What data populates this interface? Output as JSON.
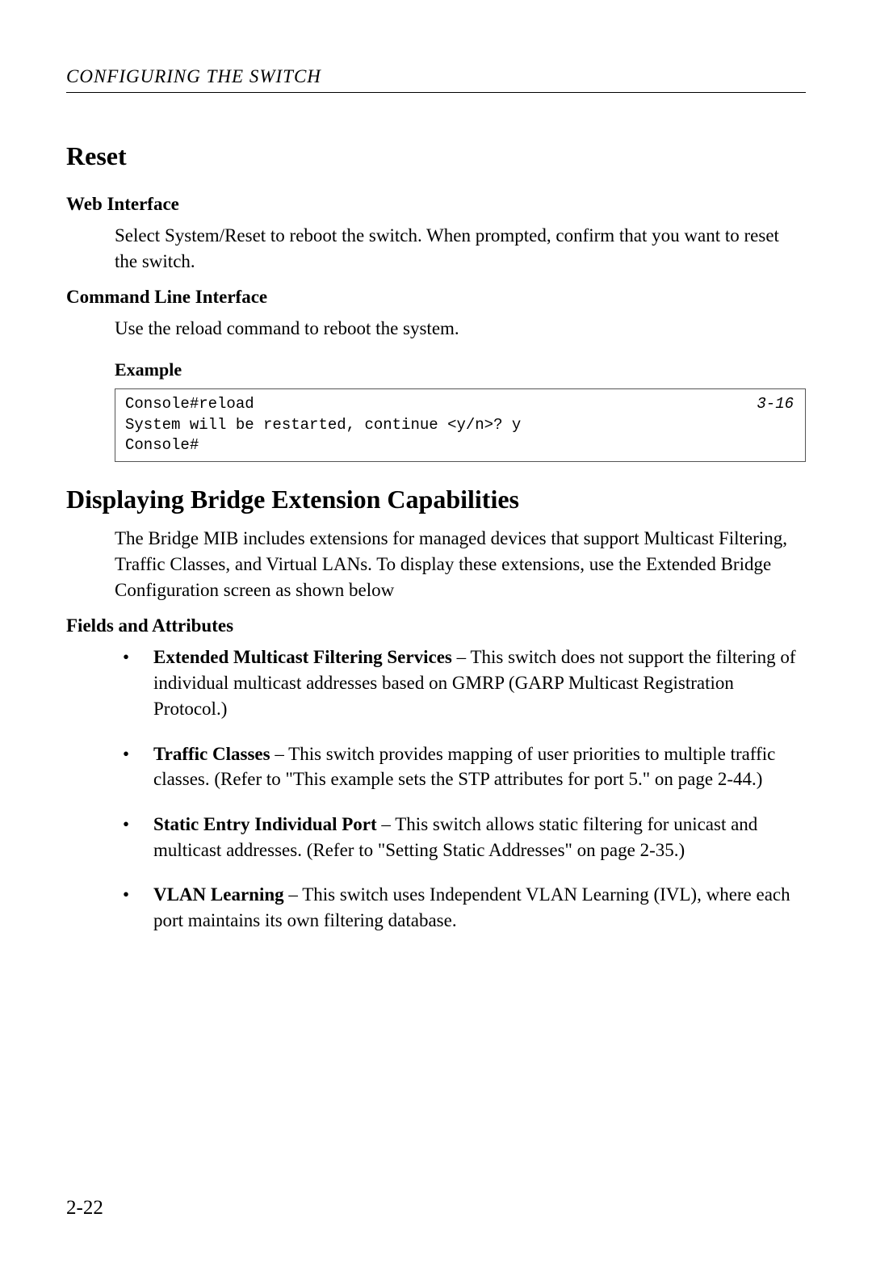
{
  "running_head": "CONFIGURING THE SWITCH",
  "section_reset": {
    "heading": "Reset",
    "web_interface_heading": "Web Interface",
    "web_interface_text": "Select System/Reset to reboot the switch. When prompted, confirm that you want to reset the switch.",
    "cli_heading": "Command Line Interface",
    "cli_text": "Use the reload command to reboot the system.",
    "example_heading": "Example",
    "example_ref": "3-16",
    "example_code": "Console#reload\nSystem will be restarted, continue <y/n>? y\nConsole#"
  },
  "section_bridge": {
    "heading": "Displaying Bridge Extension Capabilities",
    "intro_text": "The Bridge MIB includes extensions for managed devices that support Multicast Filtering, Traffic Classes, and Virtual LANs. To display these extensions, use the Extended Bridge Configuration screen as shown below",
    "fields_heading": "Fields and Attributes",
    "items": [
      {
        "term": "Extended Multicast Filtering Services",
        "desc": " – This switch does not support the filtering of individual multicast addresses based on GMRP (GARP Multicast Registration Protocol.)"
      },
      {
        "term": "Traffic Classes",
        "desc": " – This switch provides mapping of user priorities to multiple traffic classes. (Refer to \"This example sets the STP attributes for port 5.\" on page 2-44.)"
      },
      {
        "term": "Static Entry Individual Port",
        "desc": " – This switch allows static filtering for unicast and multicast addresses. (Refer to \"Setting Static Addresses\" on page 2-35.)"
      },
      {
        "term": "VLAN Learning",
        "desc": " – This switch uses Independent VLAN Learning (IVL), where each port maintains its own filtering database."
      }
    ]
  },
  "page_number": "2-22"
}
